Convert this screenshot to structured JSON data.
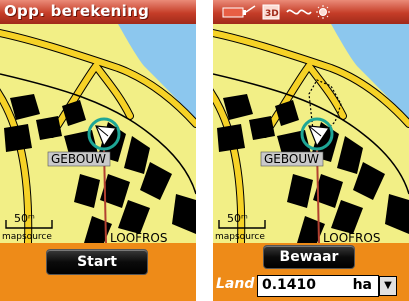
{
  "left_screen": {
    "title": "Opp. berekening",
    "map": {
      "building_label": "GEBOUW",
      "scale_text": "50ᵐ",
      "attribution": "mapsource",
      "street_label": "LOOFROS"
    },
    "start_label": "Start"
  },
  "right_screen": {
    "status_icons": [
      "battery-icon",
      "3d-icon",
      "signal-icon",
      "sun-icon"
    ],
    "status_3d_label": "3D",
    "map": {
      "building_label": "GEBOUW",
      "scale_text": "50ᵐ",
      "attribution": "mapsource",
      "street_label": "LOOFROS"
    },
    "save_label": "Bewaar",
    "land_label": "Land",
    "area_value": "0.1410",
    "area_unit": "ha"
  },
  "colors": {
    "title_bar": "#c53d28",
    "map_land": "#f2ef86",
    "road": "#f6d226",
    "water": "#8cc7ee",
    "buildings": "#000000",
    "cursor_circle": "#1ea696",
    "bottom_bar": "#ee8b18"
  }
}
